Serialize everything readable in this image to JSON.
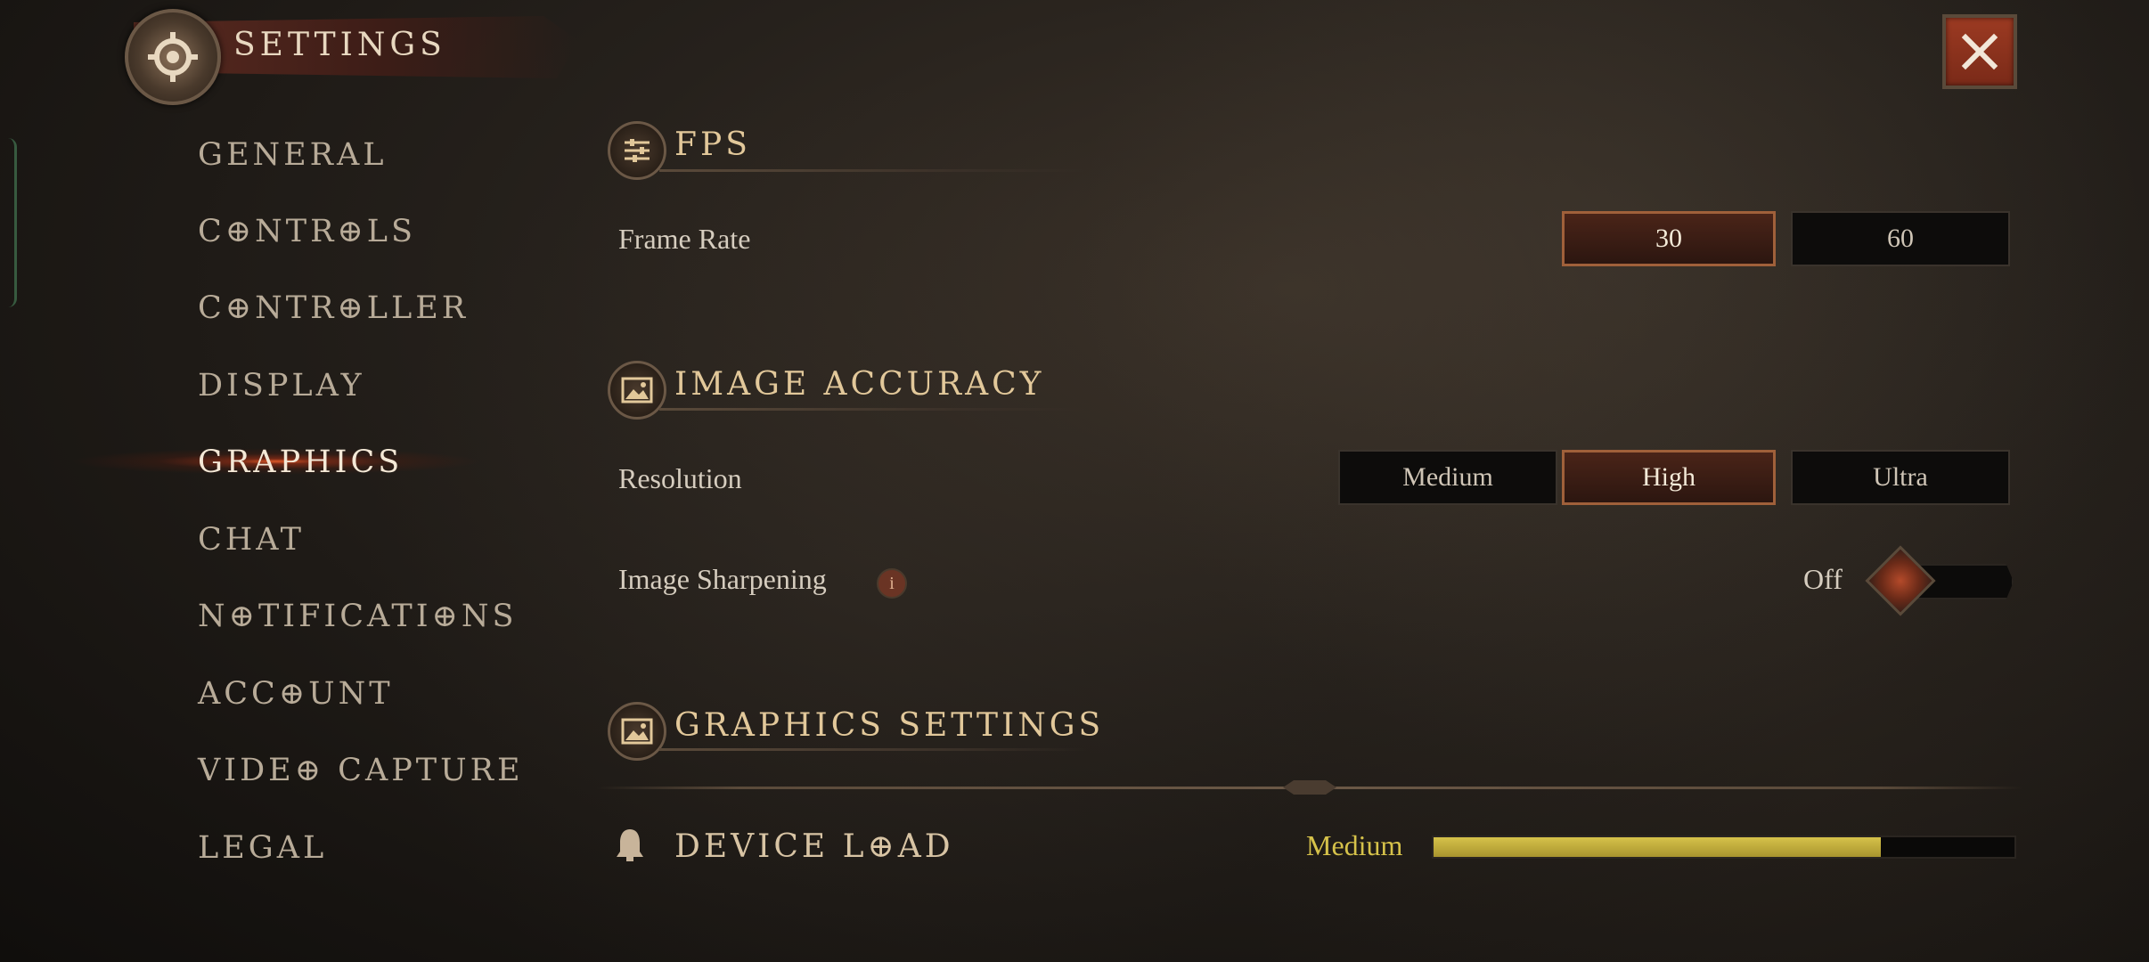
{
  "header": {
    "title": "SETTINGS"
  },
  "sidebar": {
    "items": [
      {
        "label": "GENERAL"
      },
      {
        "label": "C⊕NTR⊕LS"
      },
      {
        "label": "C⊕NTR⊕LLER"
      },
      {
        "label": "DISPLAY"
      },
      {
        "label": "GRAPHICS",
        "active": true
      },
      {
        "label": "CHAT"
      },
      {
        "label": "N⊕TIFICATI⊕NS"
      },
      {
        "label": "ACC⊕UNT"
      },
      {
        "label": "VIDE⊕ CAPTURE"
      },
      {
        "label": "LEGAL"
      }
    ]
  },
  "fps": {
    "title": "FPS",
    "frame_rate_label": "Frame Rate",
    "options": [
      "30",
      "60"
    ],
    "selected": "30"
  },
  "image_accuracy": {
    "title": "IMAGE ACCURACY",
    "resolution_label": "Resolution",
    "resolution_options": [
      "Medium",
      "High",
      "Ultra"
    ],
    "resolution_selected": "High",
    "sharpening_label": "Image Sharpening",
    "sharpening_info": "i",
    "sharpening_value": "Off"
  },
  "graphics_settings": {
    "title": "GRAPHICS SETTINGS"
  },
  "device_load": {
    "title": "DEVICE L⊕AD",
    "value_label": "Medium",
    "level_fraction": 0.77
  },
  "colors": {
    "accent_orange": "#a0603a",
    "gold_text": "#e2c89a",
    "load_bar": "#d6c24a",
    "close_red": "#9c3a22"
  }
}
